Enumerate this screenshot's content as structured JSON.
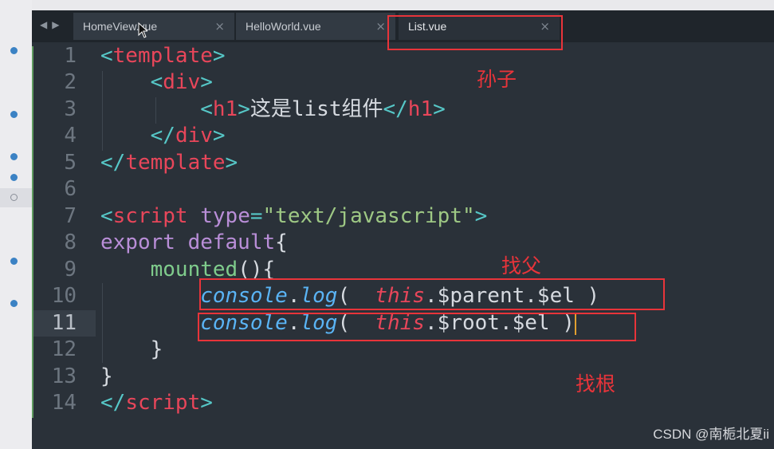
{
  "tabs": [
    {
      "label": "HomeView.vue",
      "close": "×"
    },
    {
      "label": "HelloWorld.vue",
      "close": "×"
    },
    {
      "label": "List.vue",
      "close": "×"
    }
  ],
  "nav": "◀▶",
  "lines": [
    {
      "n": "1"
    },
    {
      "n": "2"
    },
    {
      "n": "3"
    },
    {
      "n": "4"
    },
    {
      "n": "5"
    },
    {
      "n": "6"
    },
    {
      "n": "7"
    },
    {
      "n": "8"
    },
    {
      "n": "9"
    },
    {
      "n": "10"
    },
    {
      "n": "11"
    },
    {
      "n": "12"
    },
    {
      "n": "13"
    },
    {
      "n": "14"
    }
  ],
  "code": {
    "l3_text": "这是list组件",
    "l7_attr": "type",
    "l7_str": "\"text/javascript\"",
    "l8_kw": "export default",
    "l9_fn": "mounted",
    "console": "console",
    "log": "log",
    "this": "this",
    "l10_rest": ".$parent.$el )",
    "l11_rest": ".$root.$el )"
  },
  "annotations": {
    "grandchild": "孙子",
    "find_parent": "找父",
    "find_root": "找根"
  },
  "watermark": "CSDN @南栀北夏ii",
  "colors": {
    "annotation": "#e8343a",
    "tag": "#e8465a",
    "accent_dot": "#3b82c4"
  }
}
